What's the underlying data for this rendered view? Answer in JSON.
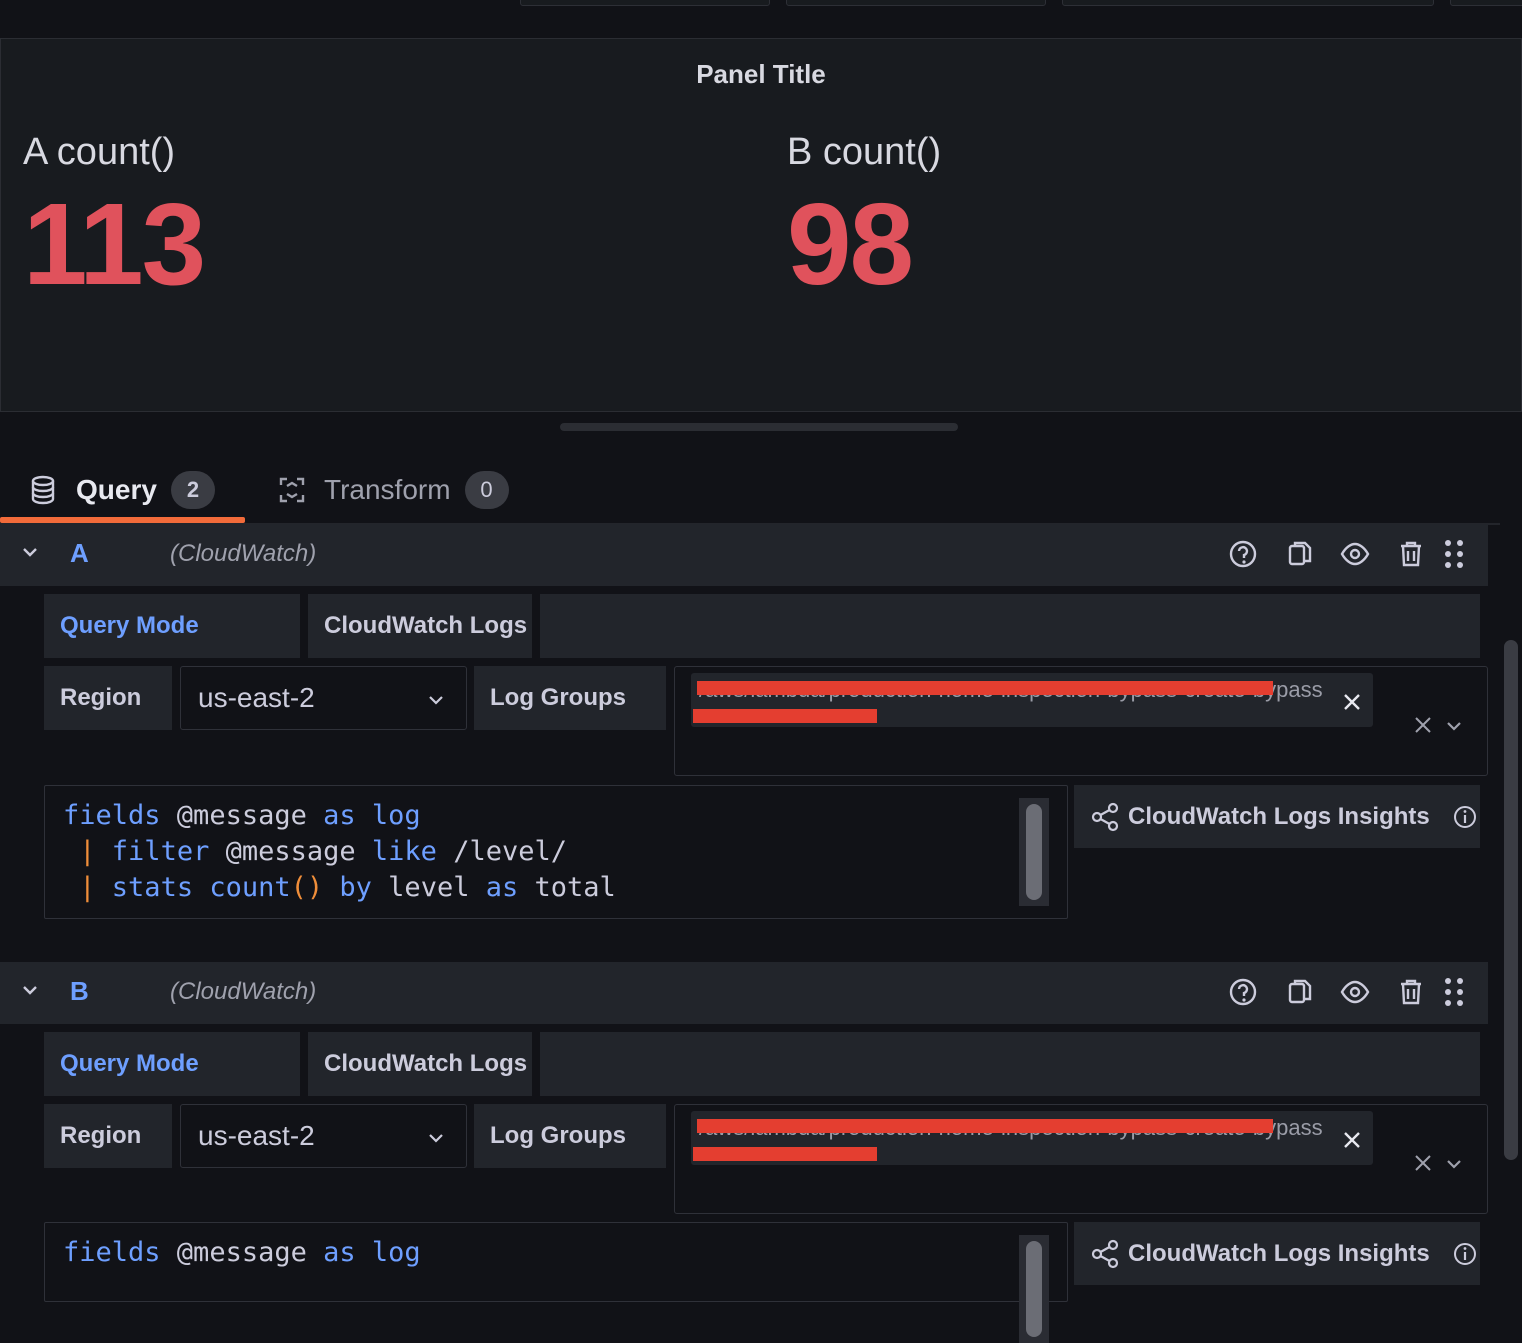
{
  "panel": {
    "title": "Panel Title",
    "stats": [
      {
        "label": "A count()",
        "value": "113"
      },
      {
        "label": "B count()",
        "value": "98"
      }
    ]
  },
  "tabs": [
    {
      "label": "Query",
      "count": "2",
      "active": true
    },
    {
      "label": "Transform",
      "count": "0",
      "active": false
    }
  ],
  "queries": [
    {
      "letter": "A",
      "datasource": "(CloudWatch)",
      "query_mode_label": "Query Mode",
      "query_mode_value": "CloudWatch Logs",
      "region_label": "Region",
      "region_value": "us-east-2",
      "log_groups_label": "Log Groups",
      "log_group_chip": "/aws/lambda/production-home-inspection-bypass-create-bypass",
      "code": [
        "fields @message as log",
        " | filter @message like /level/",
        " | stats count() by level as total"
      ],
      "insights_label": "CloudWatch Logs Insights"
    },
    {
      "letter": "B",
      "datasource": "(CloudWatch)",
      "query_mode_label": "Query Mode",
      "query_mode_value": "CloudWatch Logs",
      "region_label": "Region",
      "region_value": "us-east-2",
      "log_groups_label": "Log Groups",
      "log_group_chip": "/aws/lambda/production-home-inspection-bypass-create-bypass",
      "code": [
        "fields @message as log"
      ],
      "insights_label": "CloudWatch Logs Insights"
    }
  ],
  "colors": {
    "accent": "#6e9fff",
    "stat": "#e0525c",
    "tab_underline": "#f26b3a",
    "redaction": "#e43e30"
  },
  "icons": [
    "database-icon",
    "transform-icon",
    "help-icon",
    "copy-icon",
    "eye-icon",
    "trash-icon",
    "drag-handle-icon",
    "chevron-down-icon",
    "close-icon",
    "share-icon",
    "info-icon"
  ]
}
